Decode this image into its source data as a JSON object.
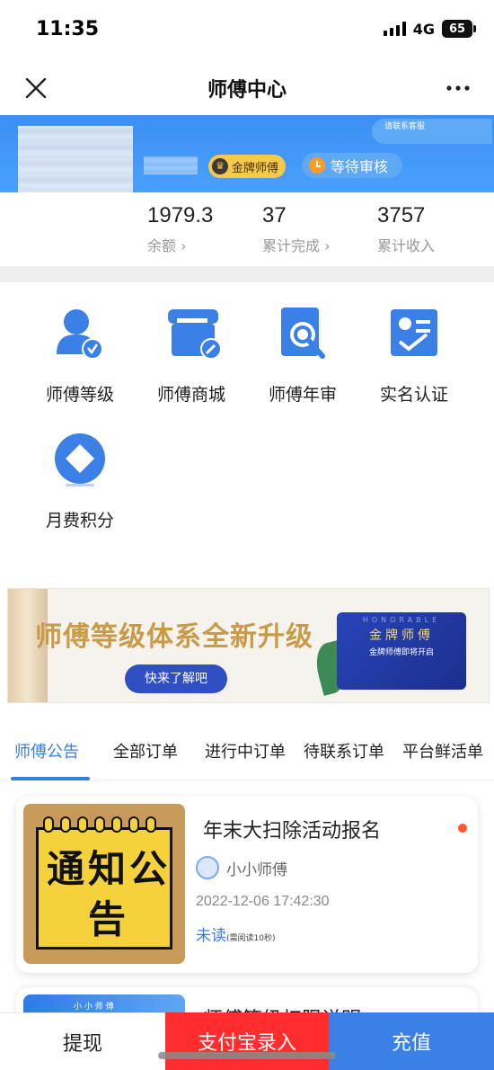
{
  "status_bar": {
    "time": "11:35",
    "network": "4G",
    "battery": "65"
  },
  "nav": {
    "title": "师傅中心"
  },
  "profile": {
    "service_label": "请联系客服",
    "gold_badge": "金牌师傅",
    "review_status": "等待审核"
  },
  "stats": [
    {
      "value": "1979.3",
      "label": "余额",
      "arrow": true
    },
    {
      "value": "37",
      "label": "累计完成",
      "arrow": true
    },
    {
      "value": "3757",
      "label": "累计收入",
      "arrow": false
    }
  ],
  "grid": [
    {
      "label": "师傅等级",
      "icon": "user-level-icon"
    },
    {
      "label": "师傅商城",
      "icon": "store-icon"
    },
    {
      "label": "师傅年审",
      "icon": "annual-review-icon"
    },
    {
      "label": "实名认证",
      "icon": "id-verify-icon"
    },
    {
      "label": "月费积分",
      "icon": "points-icon"
    }
  ],
  "banner": {
    "title": "师傅等级体系全新升级",
    "button": "快来了解吧",
    "card_top": "HONORABLE",
    "card_title": "金牌师傅",
    "card_sub": "金牌师傅即将开启"
  },
  "tabs": [
    "师傅公告",
    "全部订单",
    "进行中订单",
    "待联系订单",
    "平台鲜活单"
  ],
  "notice": {
    "thumb_text": "通知公告",
    "title": "年末大扫除活动报名",
    "author": "小小师傅",
    "date": "2022-12-06 17:42:30",
    "status": "未读",
    "status_note": "(需阅读10秒)"
  },
  "notice2": {
    "thumb_text": "小 小 师 傅",
    "title": "师傅等级权限说明"
  },
  "bottom_bar": {
    "withdraw": "提现",
    "alipay": "支付宝录入",
    "recharge": "充值"
  },
  "colors": {
    "primary": "#3a80e6",
    "alipay_red": "#ff2d2d",
    "band_blue": "#4aa0fb",
    "gold": "#f6c94a"
  }
}
